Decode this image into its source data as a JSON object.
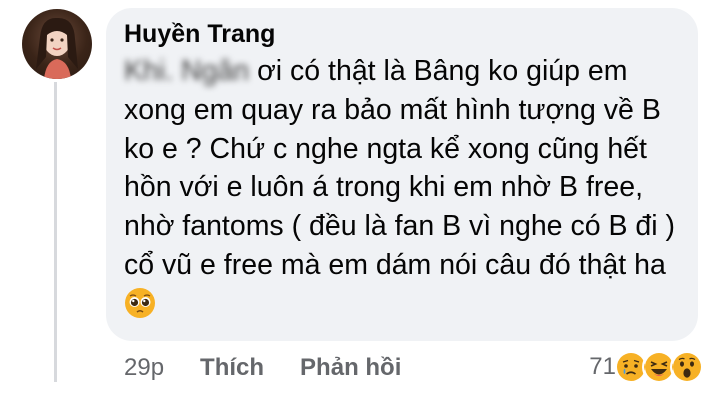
{
  "comment": {
    "author": "Huyền Trang",
    "redacted_name": "Khi. Ngân",
    "text": "ơi có thật là Bâng ko giúp em xong em quay ra bảo mất hình tượng về B ko e ? Chứ c nghe ngta kể xong cũng hết hồn với e luôn á trong khi em nhờ B free, nhờ fantoms ( đều là fan B vì nghe có B đi ) cổ vũ e free mà em dám nói câu đó thật ha",
    "inline_emoji": "pleading-face-icon"
  },
  "actions": {
    "time": "29p",
    "like_label": "Thích",
    "reply_label": "Phản hồi"
  },
  "reactions": {
    "count": "71",
    "icons": [
      "sad-face-icon",
      "haha-face-icon",
      "wow-face-icon"
    ]
  },
  "colors": {
    "bubble": "#f0f2f5",
    "text": "#050505",
    "secondary": "#65676b",
    "reaction_yellow": "#f7b125"
  }
}
